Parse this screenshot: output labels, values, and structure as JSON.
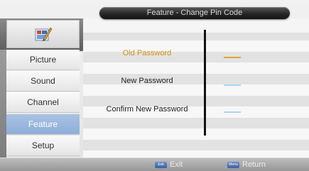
{
  "title": "Feature - Change Pin Code",
  "logo_icon": "settings-tools-icon",
  "menu": [
    {
      "label": "Picture",
      "active": false
    },
    {
      "label": "Sound",
      "active": false
    },
    {
      "label": "Channel",
      "active": false
    },
    {
      "label": "Feature",
      "active": true
    },
    {
      "label": "Setup",
      "active": false
    }
  ],
  "fields": [
    {
      "label": "Old Password",
      "value": "",
      "focused": true
    },
    {
      "label": "New Password",
      "value": "",
      "focused": false
    },
    {
      "label": "Confirm New Password",
      "value": "",
      "focused": false
    }
  ],
  "footer": {
    "exit_key": "Exit",
    "exit_label": "Exit",
    "return_key": "Menu",
    "return_label": "Return"
  },
  "colors": {
    "active_menu": "#9bb8df",
    "focused_field": "#d48f1b",
    "field_line": "#a9d6f0",
    "focused_line": "#e0a33a"
  }
}
